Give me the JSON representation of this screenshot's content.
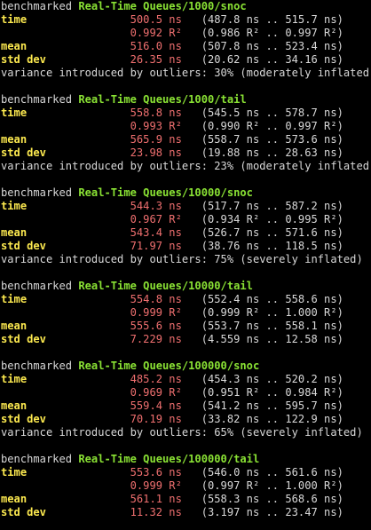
{
  "colors": {
    "background": "#000000",
    "text": "#d8d8d8",
    "benchmark_name": "#8ae234",
    "stat_label": "#fce94f",
    "estimate_value": "#ef6f6f"
  },
  "benchmarks": [
    {
      "prefix": "benchmarked",
      "name": "Real-Time Queues/1000/snoc",
      "time_label": "time",
      "time_value": "500.5 ns",
      "time_range": "(487.8 ns .. 515.7 ns)",
      "r2_value": "0.992 R²",
      "r2_range": "(0.986 R² .. 0.997 R²)",
      "mean_label": "mean",
      "mean_value": "516.0 ns",
      "mean_range": "(507.8 ns .. 523.4 ns)",
      "stddev_label": "std dev",
      "stddev_value": "26.35 ns",
      "stddev_range": "(20.62 ns .. 34.16 ns)",
      "variance": "variance introduced by outliers: 30% (moderately inflated)"
    },
    {
      "prefix": "benchmarked",
      "name": "Real-Time Queues/1000/tail",
      "time_label": "time",
      "time_value": "558.8 ns",
      "time_range": "(545.5 ns .. 578.7 ns)",
      "r2_value": "0.993 R²",
      "r2_range": "(0.990 R² .. 0.997 R²)",
      "mean_label": "mean",
      "mean_value": "565.9 ns",
      "mean_range": "(558.7 ns .. 573.6 ns)",
      "stddev_label": "std dev",
      "stddev_value": "23.98 ns",
      "stddev_range": "(19.88 ns .. 28.63 ns)",
      "variance": "variance introduced by outliers: 23% (moderately inflated)"
    },
    {
      "prefix": "benchmarked",
      "name": "Real-Time Queues/10000/snoc",
      "time_label": "time",
      "time_value": "544.3 ns",
      "time_range": "(517.7 ns .. 587.2 ns)",
      "r2_value": "0.967 R²",
      "r2_range": "(0.934 R² .. 0.995 R²)",
      "mean_label": "mean",
      "mean_value": "543.4 ns",
      "mean_range": "(526.7 ns .. 571.6 ns)",
      "stddev_label": "std dev",
      "stddev_value": "71.97 ns",
      "stddev_range": "(38.76 ns .. 118.5 ns)",
      "variance": "variance introduced by outliers: 75% (severely inflated)"
    },
    {
      "prefix": "benchmarked",
      "name": "Real-Time Queues/10000/tail",
      "time_label": "time",
      "time_value": "554.8 ns",
      "time_range": "(552.4 ns .. 558.6 ns)",
      "r2_value": "0.999 R²",
      "r2_range": "(0.999 R² .. 1.000 R²)",
      "mean_label": "mean",
      "mean_value": "555.6 ns",
      "mean_range": "(553.7 ns .. 558.1 ns)",
      "stddev_label": "std dev",
      "stddev_value": "7.229 ns",
      "stddev_range": "(4.559 ns .. 12.58 ns)",
      "variance": ""
    },
    {
      "prefix": "benchmarked",
      "name": "Real-Time Queues/100000/snoc",
      "time_label": "time",
      "time_value": "485.2 ns",
      "time_range": "(454.3 ns .. 520.2 ns)",
      "r2_value": "0.969 R²",
      "r2_range": "(0.951 R² .. 0.984 R²)",
      "mean_label": "mean",
      "mean_value": "559.4 ns",
      "mean_range": "(541.2 ns .. 595.7 ns)",
      "stddev_label": "std dev",
      "stddev_value": "70.19 ns",
      "stddev_range": "(33.82 ns .. 122.9 ns)",
      "variance": "variance introduced by outliers: 65% (severely inflated)"
    },
    {
      "prefix": "benchmarked",
      "name": "Real-Time Queues/100000/tail",
      "time_label": "time",
      "time_value": "553.6 ns",
      "time_range": "(546.0 ns .. 561.6 ns)",
      "r2_value": "0.999 R²",
      "r2_range": "(0.997 R² .. 1.000 R²)",
      "mean_label": "mean",
      "mean_value": "561.1 ns",
      "mean_range": "(558.3 ns .. 568.6 ns)",
      "stddev_label": "std dev",
      "stddev_value": "11.32 ns",
      "stddev_range": "(3.197 ns .. 23.47 ns)",
      "variance": ""
    }
  ]
}
